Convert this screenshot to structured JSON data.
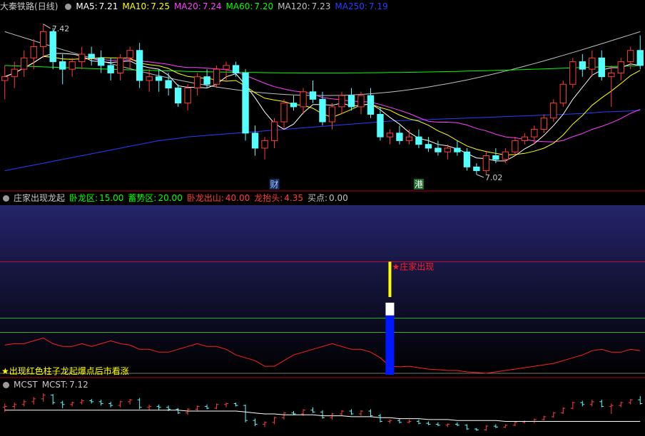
{
  "colors": {
    "up": "#ff3c3c",
    "down": "#54ffff",
    "ma5": "#ffffff",
    "ma10": "#ffff00",
    "ma20": "#ff40ff",
    "ma60": "#00ff00",
    "ma120": "#c0c0c0",
    "ma250": "#2a3cff",
    "grid_red": "#b0001c",
    "indicator_bg_top": "#24246a",
    "indicator_bg_bottom": "#000000",
    "green_line": "#2ab42a"
  },
  "main_panel": {
    "title": "大秦铁路",
    "period": "(日线)",
    "legends": [
      {
        "label": "MA5:",
        "value": "7.21",
        "color": "#ffffff"
      },
      {
        "label": "MA10:",
        "value": "7.25",
        "color": "#ffff00"
      },
      {
        "label": "MA20:",
        "value": "7.24",
        "color": "#ff40ff"
      },
      {
        "label": "MA60:",
        "value": "7.20",
        "color": "#00ff00"
      },
      {
        "label": "MA120:",
        "value": "7.23",
        "color": "#c0c0c0"
      },
      {
        "label": "MA250:",
        "value": "7.19",
        "color": "#2a3cff"
      }
    ],
    "high_label": "7.42",
    "low_label": "7.02",
    "markers": [
      {
        "text": "财",
        "color": "#9ec8ff",
        "bg": "#1a2a5a",
        "index": 28
      },
      {
        "text": "港",
        "color": "#ffffff",
        "bg": "#1a6a2a",
        "index": 43
      }
    ]
  },
  "indicator_panel": {
    "name": "庄家出现龙起",
    "legends": [
      {
        "label": "卧龙区:",
        "value": "15.00",
        "color": "#00ff00"
      },
      {
        "label": "蓄势区:",
        "value": "20.00",
        "color": "#00ff00"
      },
      {
        "label": "卧龙出山:",
        "value": "40.00",
        "color": "#ff3c3c"
      },
      {
        "label": "龙抬头:",
        "value": "4.35",
        "color": "#ff3c3c"
      },
      {
        "label": "买点:",
        "value": "0.00",
        "color": "#c0c0c0"
      }
    ],
    "signal_text": "★庄家出现",
    "note": "★出现红色柱子龙起爆点后市看涨"
  },
  "bottom_panel": {
    "name": "MCST",
    "legend_label": "MCST:",
    "legend_value": "7.12"
  },
  "chart_data": {
    "type": "candlestick",
    "series_name": "大秦铁路",
    "period": "日线",
    "yrange": [
      6.98,
      7.45
    ],
    "ohlc": [
      [
        7.27,
        7.31,
        7.22,
        7.28
      ],
      [
        7.28,
        7.32,
        7.25,
        7.3
      ],
      [
        7.3,
        7.35,
        7.28,
        7.33
      ],
      [
        7.33,
        7.38,
        7.3,
        7.36
      ],
      [
        7.36,
        7.42,
        7.33,
        7.4
      ],
      [
        7.4,
        7.41,
        7.3,
        7.32
      ],
      [
        7.32,
        7.34,
        7.26,
        7.3
      ],
      [
        7.3,
        7.33,
        7.28,
        7.32
      ],
      [
        7.32,
        7.36,
        7.3,
        7.34
      ],
      [
        7.34,
        7.36,
        7.31,
        7.33
      ],
      [
        7.33,
        7.35,
        7.29,
        7.31
      ],
      [
        7.31,
        7.33,
        7.27,
        7.29
      ],
      [
        7.29,
        7.34,
        7.27,
        7.33
      ],
      [
        7.33,
        7.36,
        7.3,
        7.35
      ],
      [
        7.35,
        7.37,
        7.25,
        7.27
      ],
      [
        7.27,
        7.3,
        7.24,
        7.28
      ],
      [
        7.28,
        7.3,
        7.24,
        7.27
      ],
      [
        7.27,
        7.29,
        7.23,
        7.25
      ],
      [
        7.25,
        7.26,
        7.2,
        7.21
      ],
      [
        7.21,
        7.26,
        7.19,
        7.25
      ],
      [
        7.25,
        7.29,
        7.23,
        7.28
      ],
      [
        7.28,
        7.3,
        7.25,
        7.26
      ],
      [
        7.26,
        7.31,
        7.25,
        7.3
      ],
      [
        7.3,
        7.32,
        7.27,
        7.31
      ],
      [
        7.31,
        7.32,
        7.28,
        7.29
      ],
      [
        7.29,
        7.3,
        7.11,
        7.13
      ],
      [
        7.13,
        7.15,
        7.07,
        7.09
      ],
      [
        7.09,
        7.12,
        7.06,
        7.11
      ],
      [
        7.11,
        7.17,
        7.09,
        7.16
      ],
      [
        7.16,
        7.22,
        7.14,
        7.21
      ],
      [
        7.21,
        7.23,
        7.19,
        7.2
      ],
      [
        7.2,
        7.25,
        7.18,
        7.24
      ],
      [
        7.24,
        7.27,
        7.21,
        7.22
      ],
      [
        7.22,
        7.24,
        7.15,
        7.16
      ],
      [
        7.16,
        7.21,
        7.14,
        7.2
      ],
      [
        7.2,
        7.24,
        7.18,
        7.23
      ],
      [
        7.23,
        7.25,
        7.19,
        7.2
      ],
      [
        7.2,
        7.24,
        7.18,
        7.23
      ],
      [
        7.23,
        7.25,
        7.17,
        7.18
      ],
      [
        7.18,
        7.2,
        7.11,
        7.12
      ],
      [
        7.12,
        7.14,
        7.1,
        7.13
      ],
      [
        7.13,
        7.15,
        7.1,
        7.11
      ],
      [
        7.11,
        7.14,
        7.1,
        7.12
      ],
      [
        7.12,
        7.14,
        7.09,
        7.1
      ],
      [
        7.1,
        7.12,
        7.08,
        7.09
      ],
      [
        7.09,
        7.11,
        7.07,
        7.08
      ],
      [
        7.08,
        7.1,
        7.06,
        7.09
      ],
      [
        7.09,
        7.11,
        7.07,
        7.08
      ],
      [
        7.08,
        7.09,
        7.03,
        7.04
      ],
      [
        7.04,
        7.05,
        7.02,
        7.03
      ],
      [
        7.03,
        7.08,
        7.02,
        7.07
      ],
      [
        7.07,
        7.09,
        7.05,
        7.06
      ],
      [
        7.06,
        7.09,
        7.05,
        7.08
      ],
      [
        7.08,
        7.12,
        7.07,
        7.11
      ],
      [
        7.11,
        7.13,
        7.1,
        7.12
      ],
      [
        7.12,
        7.15,
        7.1,
        7.14
      ],
      [
        7.14,
        7.18,
        7.13,
        7.17
      ],
      [
        7.17,
        7.22,
        7.16,
        7.21
      ],
      [
        7.21,
        7.27,
        7.2,
        7.26
      ],
      [
        7.26,
        7.33,
        7.25,
        7.32
      ],
      [
        7.32,
        7.34,
        7.28,
        7.3
      ],
      [
        7.3,
        7.35,
        7.28,
        7.33
      ],
      [
        7.33,
        7.35,
        7.27,
        7.28
      ],
      [
        7.28,
        7.31,
        7.2,
        7.29
      ],
      [
        7.29,
        7.33,
        7.27,
        7.32
      ],
      [
        7.32,
        7.36,
        7.3,
        7.35
      ],
      [
        7.35,
        7.39,
        7.3,
        7.31
      ]
    ],
    "mcst": [
      7.24,
      7.24,
      7.24,
      7.24,
      7.24,
      7.24,
      7.24,
      7.24,
      7.24,
      7.24,
      7.24,
      7.24,
      7.24,
      7.24,
      7.24,
      7.24,
      7.24,
      7.24,
      7.24,
      7.23,
      7.23,
      7.23,
      7.23,
      7.23,
      7.23,
      7.22,
      7.21,
      7.2,
      7.2,
      7.19,
      7.19,
      7.19,
      7.19,
      7.18,
      7.18,
      7.18,
      7.17,
      7.17,
      7.17,
      7.16,
      7.16,
      7.15,
      7.15,
      7.15,
      7.14,
      7.14,
      7.14,
      7.13,
      7.13,
      7.13,
      7.13,
      7.13,
      7.12,
      7.12,
      7.12,
      7.12,
      7.12,
      7.12,
      7.12,
      7.12,
      7.12,
      7.12,
      7.12,
      7.12,
      7.12,
      7.12,
      7.12
    ],
    "ma250": [
      7.03,
      7.035,
      7.04,
      7.045,
      7.05,
      7.055,
      7.06,
      7.065,
      7.07,
      7.075,
      7.08,
      7.085,
      7.09,
      7.095,
      7.1,
      7.105,
      7.11,
      7.113,
      7.116,
      7.12,
      7.122,
      7.124,
      7.126,
      7.128,
      7.13,
      7.132,
      7.134,
      7.136,
      7.138,
      7.14,
      7.142,
      7.144,
      7.146,
      7.148,
      7.15,
      7.152,
      7.154,
      7.156,
      7.158,
      7.16,
      7.162,
      7.163,
      7.164,
      7.165,
      7.166,
      7.167,
      7.168,
      7.169,
      7.17,
      7.171,
      7.172,
      7.173,
      7.174,
      7.175,
      7.176,
      7.177,
      7.178,
      7.179,
      7.18,
      7.181,
      7.182,
      7.184,
      7.186,
      7.187,
      7.188,
      7.189,
      7.19
    ],
    "indicator": {
      "levels": {
        "卧龙区": 15,
        "蓄势区": 20,
        "卧龙出山": 40
      },
      "yrange": [
        0,
        60
      ],
      "line": [
        10.5,
        11,
        11,
        12,
        13,
        11,
        10,
        10,
        11,
        10,
        11,
        12,
        11,
        10.5,
        9,
        9,
        8,
        8,
        9,
        10,
        11,
        10,
        10,
        9,
        7,
        6,
        5,
        3,
        3,
        5,
        7,
        8,
        9,
        10,
        11,
        10,
        9,
        9,
        8,
        6,
        3,
        2.8,
        3,
        2.5,
        2,
        1.8,
        1.5,
        1.5,
        1,
        0.8,
        0.5,
        1,
        1.5,
        2,
        2.5,
        3,
        3.5,
        4,
        5,
        6,
        7,
        8.5,
        9,
        8,
        8,
        9,
        8.5
      ],
      "signal_bar": {
        "index": 40,
        "top_yellow": [
          29,
          40
        ],
        "white": [
          21,
          25
        ],
        "blue": [
          0,
          21
        ]
      }
    }
  }
}
